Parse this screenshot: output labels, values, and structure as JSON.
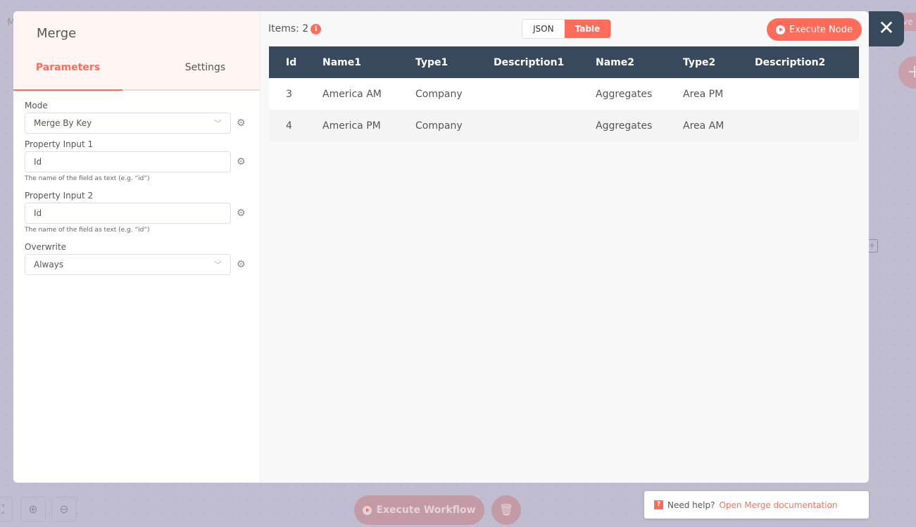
{
  "background": {
    "canvas_label": "M",
    "save_label": "ve",
    "execute_workflow": "Execute Workflow"
  },
  "panel": {
    "title": "Merge",
    "tabs": [
      {
        "label": "Parameters",
        "active": true
      },
      {
        "label": "Settings",
        "active": false
      }
    ],
    "fields": [
      {
        "label": "Mode",
        "value": "Merge By Key",
        "type": "select"
      },
      {
        "label": "Property Input 1",
        "value": "Id",
        "hint": "The name of the field as text (e.g. “id”)"
      },
      {
        "label": "Property Input 2",
        "value": "Id",
        "hint": "The name of the field as text (e.g. “id”)"
      },
      {
        "label": "Overwrite",
        "value": "Always",
        "type": "select"
      }
    ]
  },
  "output": {
    "items_label": "Items: 2",
    "info_icon": "i",
    "view_toggle": {
      "json": "JSON",
      "table": "Table",
      "selected": "Table"
    },
    "execute_node": "Execute Node",
    "columns": [
      "Id",
      "Name1",
      "Type1",
      "Description1",
      "Name2",
      "Type2",
      "Description2"
    ],
    "rows": [
      [
        "3",
        "America AM",
        "Company",
        "",
        "Aggregates",
        "Area PM",
        ""
      ],
      [
        "4",
        "America PM",
        "Company",
        "",
        "Aggregates",
        "Area AM",
        ""
      ]
    ]
  },
  "help": {
    "icon": "?",
    "prefix": "Need help?",
    "link": "Open Merge documentation"
  },
  "colors": {
    "accent": "#ff6d5a",
    "header": "#37495a"
  }
}
